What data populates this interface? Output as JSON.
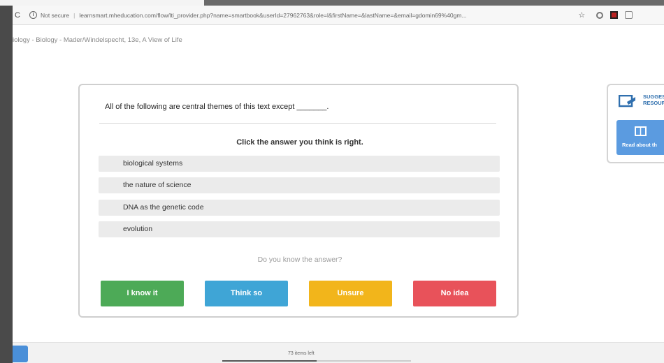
{
  "browser": {
    "security_label": "Not secure",
    "url": "learnsmart.mheducation.com/flow/lti_provider.php?name=smartbook&userId=27962763&role=l&firstName=&lastName=&email=gdomin69%40gm..."
  },
  "breadcrumb": "iology - Biology - Mader/Windelspecht, 13e, A View of Life",
  "question": {
    "text": "All of the following are central themes of this text except _______.",
    "instruction": "Click the answer you think is right.",
    "answers": [
      "biological systems",
      "the nature of science",
      "DNA as the genetic code",
      "evolution"
    ]
  },
  "confidence": {
    "prompt": "Do you know the answer?",
    "buttons": [
      {
        "label": "I know it",
        "color": "#4daa57"
      },
      {
        "label": "Think so",
        "color": "#3fa5d6"
      },
      {
        "label": "Unsure",
        "color": "#f2b51b"
      },
      {
        "label": "No idea",
        "color": "#e8525a"
      }
    ]
  },
  "side_panel": {
    "title_line1": "SUGGES",
    "title_line2": "RESOUR",
    "read_button_label": "Read about th",
    "accent": "#5b9be0"
  },
  "footer": {
    "items_left": "73 items left",
    "progress_fraction": 0.5
  }
}
